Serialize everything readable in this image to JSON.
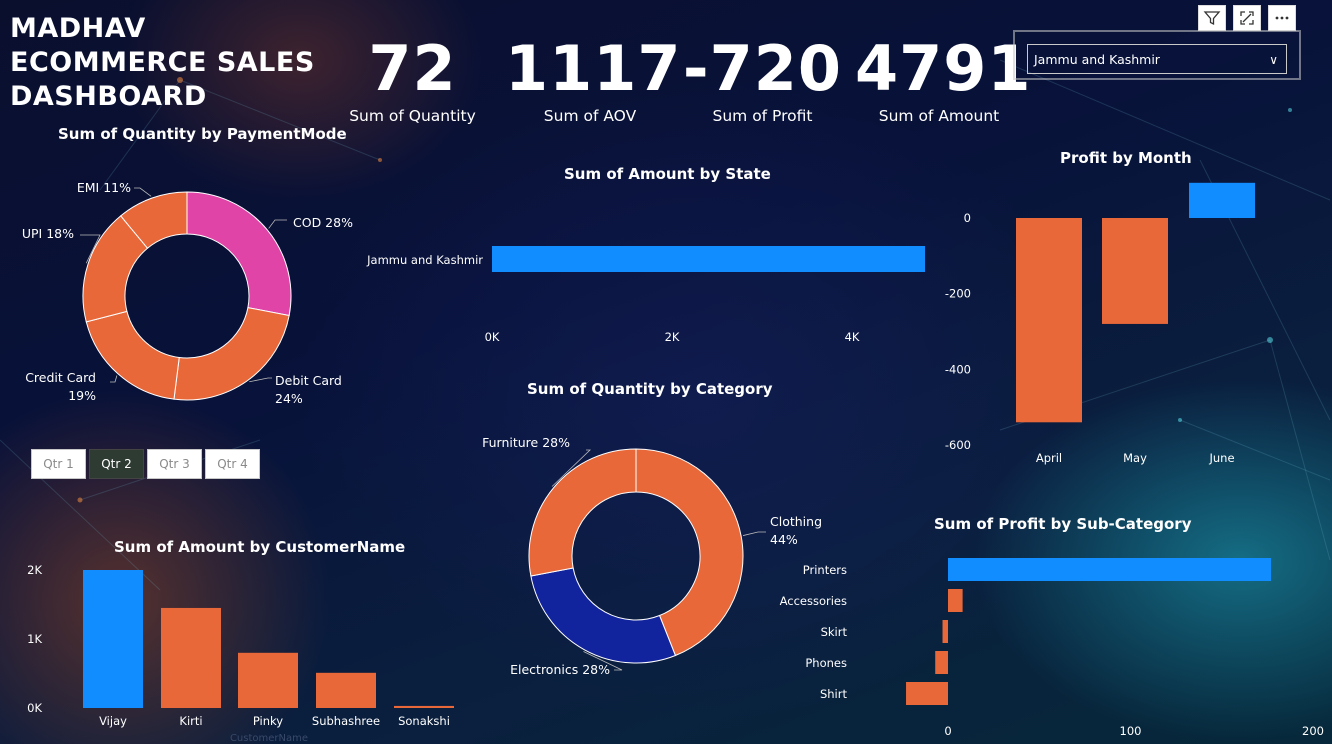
{
  "title": "MADHAV ECOMMERCE SALES DASHBOARD",
  "kpis": [
    {
      "value": "72",
      "label": "Sum of Quantity"
    },
    {
      "value": "1117",
      "label": "Sum of AOV"
    },
    {
      "value": "-720",
      "label": "Sum of Profit"
    },
    {
      "value": "4791",
      "label": "Sum of Amount"
    }
  ],
  "state_slicer": {
    "selected": "Jammu and Kashmir"
  },
  "toolbar": {
    "icons": [
      "filter-icon",
      "focus-mode-icon",
      "more-options-icon"
    ]
  },
  "quarter_slicer": {
    "options": [
      "Qtr 1",
      "Qtr 2",
      "Qtr 3",
      "Qtr 4"
    ],
    "selected": "Qtr 2"
  },
  "colors": {
    "orange": "#e8683a",
    "blue": "#118dff",
    "magenta": "#e044a7",
    "navy": "#12239e"
  },
  "chart_data": [
    {
      "id": "payment",
      "type": "pie",
      "title": "Sum of Quantity by PaymentMode",
      "categories": [
        "COD",
        "Debit Card",
        "Credit Card",
        "UPI",
        "EMI"
      ],
      "values": [
        28,
        24,
        19,
        18,
        11
      ],
      "labels": [
        "COD 28%",
        "Debit Card 24%",
        "Credit Card 19%",
        "UPI 18%",
        "EMI 11%"
      ],
      "colors": [
        "#e044a7",
        "#e8683a",
        "#e8683a",
        "#e8683a",
        "#e8683a"
      ]
    },
    {
      "id": "state",
      "type": "bar",
      "title": "Sum of Amount by State",
      "categories": [
        "Jammu and Kashmir"
      ],
      "values": [
        4791
      ],
      "xticks": [
        "0K",
        "2K",
        "4K"
      ],
      "xlim": [
        0,
        4800
      ]
    },
    {
      "id": "month",
      "type": "bar",
      "title": "Profit by Month",
      "categories": [
        "April",
        "May",
        "June"
      ],
      "values": [
        -540,
        -280,
        93
      ],
      "ylim": [
        -600,
        100
      ],
      "yticks": [
        "0",
        "-200",
        "-400",
        "-600"
      ],
      "colors": [
        "#e8683a",
        "#e8683a",
        "#118dff"
      ]
    },
    {
      "id": "category",
      "type": "pie",
      "title": "Sum of Quantity by Category",
      "categories": [
        "Clothing",
        "Electronics",
        "Furniture"
      ],
      "values": [
        44,
        28,
        28
      ],
      "labels": [
        "Clothing 44%",
        "Electronics 28%",
        "Furniture 28%"
      ],
      "colors": [
        "#e8683a",
        "#12239e",
        "#e8683a"
      ]
    },
    {
      "id": "customer",
      "type": "bar",
      "title": "Sum of Amount by CustomerName",
      "xlabel": "CustomerName",
      "categories": [
        "Vijay",
        "Kirti",
        "Pinky",
        "Subhashree",
        "Sonakshi"
      ],
      "values": [
        2000,
        1450,
        800,
        510,
        30
      ],
      "ylim": [
        0,
        2000
      ],
      "yticks": [
        "0K",
        "1K",
        "2K"
      ],
      "colors": [
        "#118dff",
        "#e8683a",
        "#e8683a",
        "#e8683a",
        "#e8683a"
      ]
    },
    {
      "id": "subcat",
      "type": "bar",
      "title": "Sum of Profit by Sub-Category",
      "categories": [
        "Printers",
        "Accessories",
        "Skirt",
        "Phones",
        "Shirt"
      ],
      "values": [
        177,
        8,
        -3,
        -7,
        -23
      ],
      "xlim": [
        -23,
        200
      ],
      "xticks": [
        "0",
        "100",
        "200"
      ],
      "colors": [
        "#118dff",
        "#e8683a",
        "#e8683a",
        "#e8683a",
        "#e8683a"
      ]
    }
  ]
}
